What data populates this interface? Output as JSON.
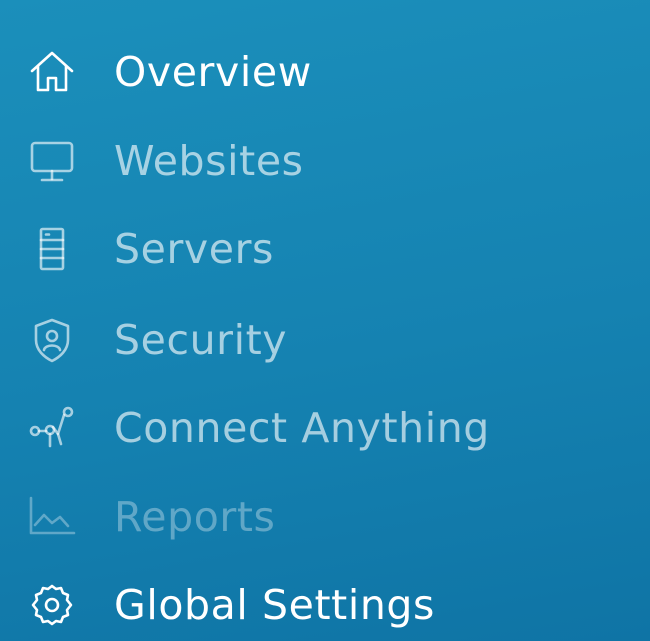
{
  "nav": {
    "items": [
      {
        "label": "Overview",
        "icon": "home-icon",
        "state": "active"
      },
      {
        "label": "Websites",
        "icon": "monitor-icon",
        "state": "default"
      },
      {
        "label": "Servers",
        "icon": "server-icon",
        "state": "default"
      },
      {
        "label": "Security",
        "icon": "shield-user-icon",
        "state": "default"
      },
      {
        "label": "Connect Anything",
        "icon": "connect-nodes-icon",
        "state": "default"
      },
      {
        "label": "Reports",
        "icon": "area-chart-icon",
        "state": "disabled"
      },
      {
        "label": "Global Settings",
        "icon": "gear-icon",
        "state": "active"
      }
    ]
  },
  "colors": {
    "background_top": "#1b8fbb",
    "background_bottom": "#0f74a5",
    "text_active": "#ffffff"
  }
}
